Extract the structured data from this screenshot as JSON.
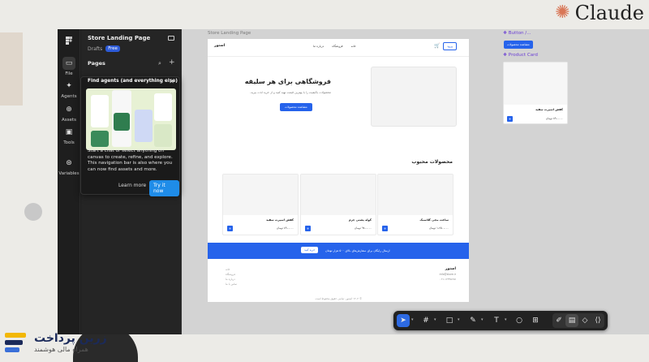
{
  "watermark": {
    "brand_right": "Claude",
    "brand_left_title": "زرین پرداخت",
    "brand_left_tagline": "همراه مالی هوشمند"
  },
  "sidebar": {
    "file_title": "Store Landing Page",
    "status": "Drafts",
    "plan_badge": "Free",
    "pages_label": "Pages",
    "rail": [
      {
        "label": "File",
        "icon": "file-icon"
      },
      {
        "label": "Agents",
        "icon": "agents-icon"
      },
      {
        "label": "Assets",
        "icon": "assets-icon"
      },
      {
        "label": "Tools",
        "icon": "tools-icon"
      },
      {
        "label": "Variables",
        "icon": "variables-icon"
      }
    ]
  },
  "popover": {
    "title": "Find agents (and everything else)",
    "body": "Start a chat or select anything on canvas to create, refine, and explore. This navigation bar is also where you can now find assets and more.",
    "learn_more": "Learn more",
    "try_it": "Try it now"
  },
  "canvas": {
    "frame_label": "Store Landing Page",
    "components": {
      "button_label": "Button /...",
      "card_label": "Product Card",
      "button_text": "مشاهده محصولات",
      "card_name": "کفش اسپرت سفید",
      "card_price": "۸۹۰،۰۰۰ تومان"
    },
    "page": {
      "logo": "استور",
      "nav_links": [
        "درباره ما",
        "فروشگاه",
        "خانه"
      ],
      "login": "ورود",
      "hero_title": "فروشگاهی برای هر سلیقه",
      "hero_desc": "محصولات باکیفیت را با بهترین قیمت تهیه کنید و از خرید لذت ببرید.",
      "hero_button": "مشاهده محصولات",
      "section_title": "محصولات محبوب",
      "products": [
        {
          "name": "ساعت مچی کلاسیک",
          "price": "۱،۲۵۰،۰۰۰ تومان"
        },
        {
          "name": "کوله پشتی چرم",
          "price": "۹۸۰،۰۰۰ تومان"
        },
        {
          "name": "کفش اسپرت سفید",
          "price": "۸۹۰،۰۰۰ تومان"
        }
      ],
      "banner_text": "ارسال رایگان برای سفارش‌های بالای ۵۰۰ هزار تومان",
      "banner_button": "خرید کنید",
      "footer_brand": "استور",
      "footer_contact": [
        "info@store.ir",
        "۰۲۱-۱۲۳۴۵۶۷۸"
      ],
      "footer_links": [
        "خانه",
        "فروشگاه",
        "درباره ما",
        "تماس با ما"
      ],
      "copyright": "© ۱۴۰۴ استور. تمامی حقوق محفوظ است."
    }
  },
  "toolbar": {
    "tools": [
      "move-tool-icon",
      "frame-tool-icon",
      "rectangle-tool-icon",
      "pen-tool-icon",
      "text-tool-icon",
      "comment-tool-icon",
      "actions-icon",
      "draw-mode-icon",
      "design-mode-icon",
      "prototype-mode-icon",
      "dev-mode-icon"
    ]
  }
}
